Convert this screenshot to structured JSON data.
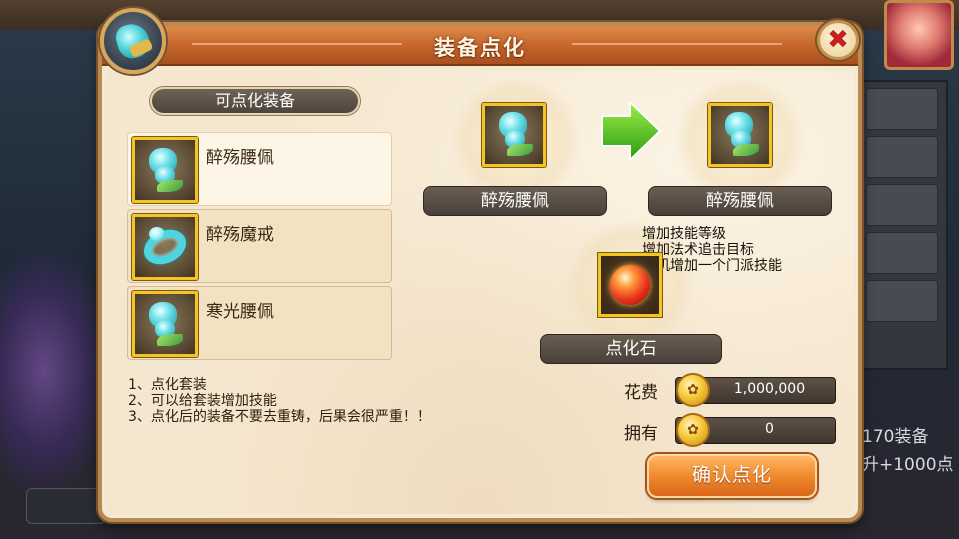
{
  "dialog": {
    "title": "装备点化",
    "close_glyph": "✖"
  },
  "list": {
    "header": "可点化装备",
    "items": [
      {
        "name": "醉殇腰佩",
        "icon": "waist-pendant-icon",
        "selected": true
      },
      {
        "name": "醉殇魔戒",
        "icon": "ring-icon",
        "selected": false
      },
      {
        "name": "寒光腰佩",
        "icon": "waist-pendant-icon",
        "selected": false
      }
    ]
  },
  "notes": [
    "1、点化套装",
    "2、可以给套装增加技能",
    "3、点化后的装备不要去重铸，后果会很严重！！"
  ],
  "source_item": {
    "name": "醉殇腰佩"
  },
  "result_item": {
    "name": "醉殇腰佩"
  },
  "effects": [
    "增加技能等级",
    "增加法术追击目标",
    "随机增加一个门派技能"
  ],
  "material": {
    "name": "点化石"
  },
  "cost": {
    "cost_label": "花费",
    "cost_value": "1,000,000",
    "own_label": "拥有",
    "own_value": "0"
  },
  "confirm_button": "确认点化",
  "background": {
    "right_text_1": "170装备",
    "right_text_2": "升+1000点"
  },
  "colors": {
    "accent_orange": "#f08a2e",
    "icon_border_gold": "#f4c522",
    "arrow_green": "#4cc21c"
  }
}
